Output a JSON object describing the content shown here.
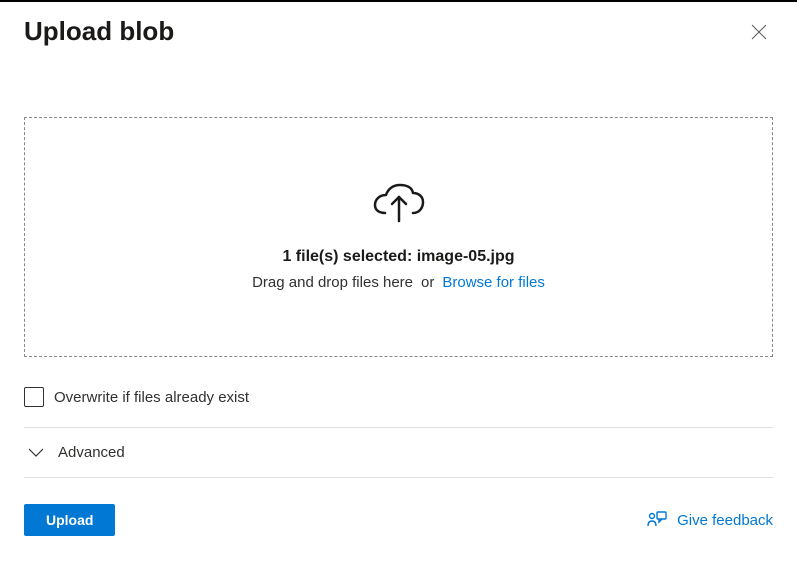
{
  "header": {
    "title": "Upload blob"
  },
  "dropzone": {
    "selected_text": "1 file(s) selected: image-05.jpg",
    "dragdrop_text": "Drag and drop files here",
    "or_text": "or",
    "browse_label": "Browse for files"
  },
  "overwrite": {
    "label": "Overwrite if files already exist",
    "checked": false
  },
  "advanced": {
    "label": "Advanced",
    "expanded": false
  },
  "footer": {
    "upload_label": "Upload",
    "feedback_label": "Give feedback"
  }
}
